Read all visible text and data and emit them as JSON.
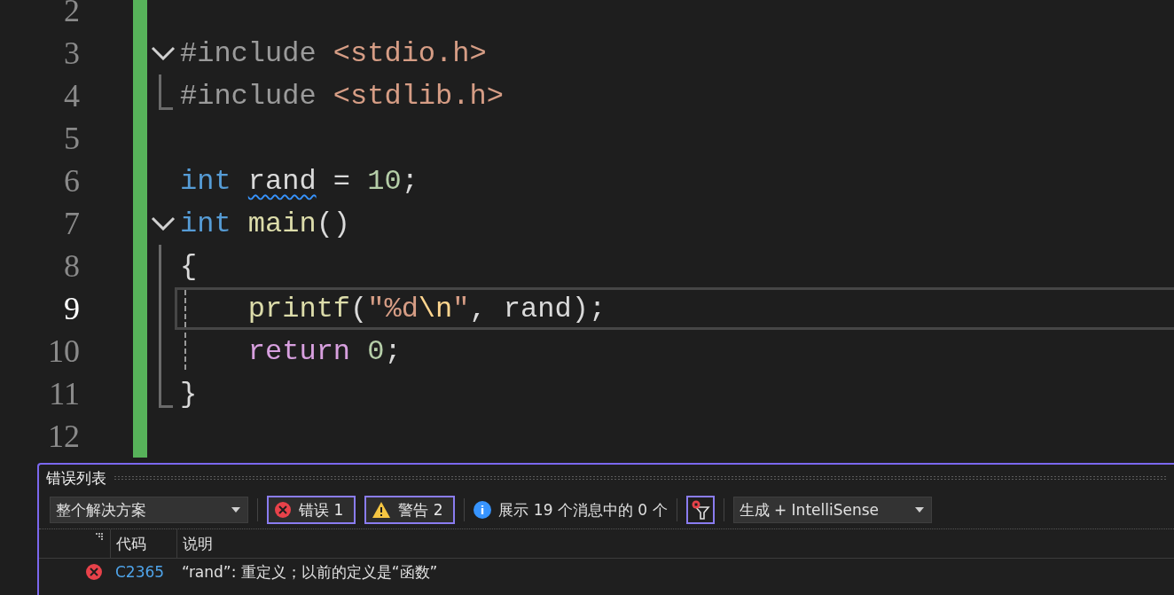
{
  "editor": {
    "lines": [
      {
        "number": "2",
        "current": false,
        "kind": "plain"
      },
      {
        "number": "3",
        "current": false,
        "kind": "fold-start",
        "tokens": [
          {
            "kind": "preprocessor",
            "text": "#include "
          },
          {
            "kind": "string",
            "text": "<stdio.h>"
          }
        ]
      },
      {
        "number": "4",
        "current": false,
        "kind": "fold-end",
        "tokens": [
          {
            "kind": "preprocessor",
            "text": "#include "
          },
          {
            "kind": "string",
            "text": "<stdlib.h>"
          }
        ]
      },
      {
        "number": "5",
        "current": false,
        "kind": "plain"
      },
      {
        "number": "6",
        "current": false,
        "kind": "plain",
        "tokens": [
          {
            "kind": "keyword",
            "text": "int "
          },
          {
            "kind": "error-ident",
            "text": "rand"
          },
          {
            "kind": "plain",
            "text": " = "
          },
          {
            "kind": "number",
            "text": "10"
          },
          {
            "kind": "plain",
            "text": ";"
          }
        ]
      },
      {
        "number": "7",
        "current": false,
        "kind": "fold-start",
        "tokens": [
          {
            "kind": "keyword",
            "text": "int "
          },
          {
            "kind": "function",
            "text": "main"
          },
          {
            "kind": "plain",
            "text": "()"
          }
        ]
      },
      {
        "number": "8",
        "current": false,
        "kind": "fold-inner",
        "tokens": [
          {
            "kind": "plain",
            "text": "{"
          }
        ]
      },
      {
        "number": "9",
        "current": true,
        "kind": "fold-inner-guided",
        "tokens": [
          {
            "kind": "function",
            "text": "printf"
          },
          {
            "kind": "plain",
            "text": "("
          },
          {
            "kind": "string",
            "text": "\"%d"
          },
          {
            "kind": "escape",
            "text": "\\n"
          },
          {
            "kind": "string",
            "text": "\""
          },
          {
            "kind": "plain",
            "text": ", rand);"
          }
        ]
      },
      {
        "number": "10",
        "current": false,
        "kind": "fold-inner-guided",
        "tokens": [
          {
            "kind": "control",
            "text": "return "
          },
          {
            "kind": "number",
            "text": "0"
          },
          {
            "kind": "plain",
            "text": ";"
          }
        ]
      },
      {
        "number": "11",
        "current": false,
        "kind": "fold-end",
        "tokens": [
          {
            "kind": "plain",
            "text": "}"
          }
        ]
      },
      {
        "number": "12",
        "current": false,
        "kind": "plain"
      }
    ]
  },
  "error_list": {
    "title": "错误列表",
    "scope": "整个解决方案",
    "toggles": [
      {
        "kind": "error",
        "label": "错误 1",
        "selected": true
      },
      {
        "kind": "warning",
        "label": "警告 2",
        "selected": true
      }
    ],
    "info": "展示 19 个消息中的 0 个",
    "filter_selected": true,
    "source": "生成 + IntelliSense",
    "columns": [
      "代码",
      "说明"
    ],
    "rows": [
      {
        "kind": "error",
        "code": "C2365",
        "description": "“rand”: 重定义；以前的定义是“函数”"
      }
    ]
  }
}
